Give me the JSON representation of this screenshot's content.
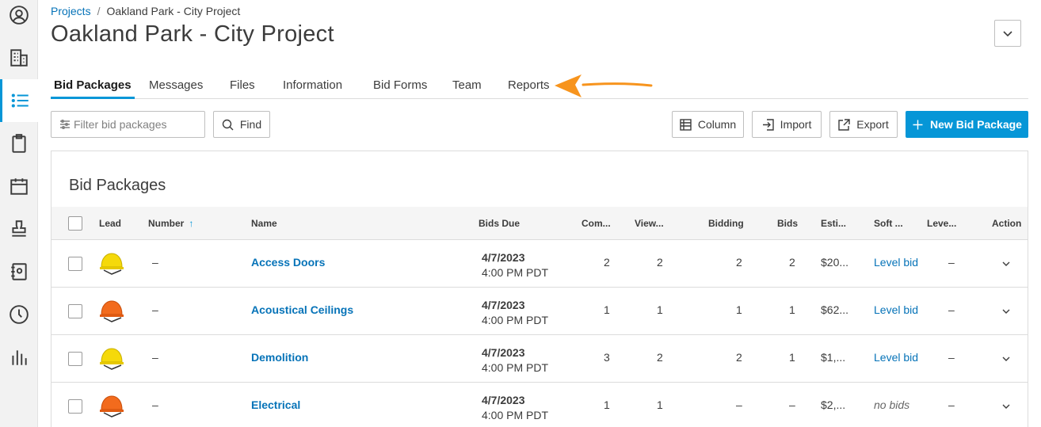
{
  "sidebar": {
    "items": [
      {
        "icon": "user-circle-icon"
      },
      {
        "icon": "building-icon"
      },
      {
        "icon": "list-icon",
        "active": true
      },
      {
        "icon": "clipboard-icon"
      },
      {
        "icon": "calendar-icon"
      },
      {
        "icon": "stamp-icon"
      },
      {
        "icon": "address-book-icon"
      },
      {
        "icon": "clock-icon"
      },
      {
        "icon": "bar-chart-icon"
      }
    ]
  },
  "breadcrumb": {
    "parent": "Projects",
    "separator": "/",
    "current": "Oakland Park - City Project"
  },
  "page_title": "Oakland Park - City Project",
  "tabs": [
    "Bid Packages",
    "Messages",
    "Files",
    "Information",
    "Bid Forms",
    "Team",
    "Reports"
  ],
  "active_tab": "Bid Packages",
  "toolbar": {
    "filter_placeholder": "Filter bid packages",
    "find_label": "Find",
    "column_label": "Column",
    "import_label": "Import",
    "export_label": "Export",
    "new_label": "New Bid Package"
  },
  "panel_title": "Bid Packages",
  "columns": {
    "lead": "Lead",
    "number": "Number",
    "name": "Name",
    "bids_due": "Bids Due",
    "com": "Com...",
    "view": "View...",
    "bidding": "Bidding",
    "bids": "Bids",
    "esti": "Esti...",
    "soft": "Soft ...",
    "leve": "Leve...",
    "action": "Action"
  },
  "rows": [
    {
      "lead": "yellow",
      "number": "–",
      "name": "Access Doors",
      "date": "4/7/2023",
      "time": "4:00 PM PDT",
      "com": "2",
      "view": "2",
      "bidding": "2",
      "bids": "2",
      "esti": "$20...",
      "soft": "Level bid",
      "soft_link": true,
      "leve": "–"
    },
    {
      "lead": "orange",
      "number": "–",
      "name": "Acoustical Ceilings",
      "date": "4/7/2023",
      "time": "4:00 PM PDT",
      "com": "1",
      "view": "1",
      "bidding": "1",
      "bids": "1",
      "esti": "$62...",
      "soft": "Level bid",
      "soft_link": true,
      "leve": "–"
    },
    {
      "lead": "yellow",
      "number": "–",
      "name": "Demolition",
      "date": "4/7/2023",
      "time": "4:00 PM PDT",
      "com": "3",
      "view": "2",
      "bidding": "2",
      "bids": "1",
      "esti": "$1,...",
      "soft": "Level bid",
      "soft_link": true,
      "leve": "–"
    },
    {
      "lead": "orange",
      "number": "–",
      "name": "Electrical",
      "date": "4/7/2023",
      "time": "4:00 PM PDT",
      "com": "1",
      "view": "1",
      "bidding": "–",
      "bids": "–",
      "esti": "$2,...",
      "soft": "no bids",
      "soft_link": false,
      "leve": "–"
    }
  ],
  "colors": {
    "accent": "#0696d7",
    "link": "#0673b8",
    "arrow": "#f7941d",
    "helmet_yellow": "#f5d90a",
    "helmet_orange": "#f26b1d"
  }
}
